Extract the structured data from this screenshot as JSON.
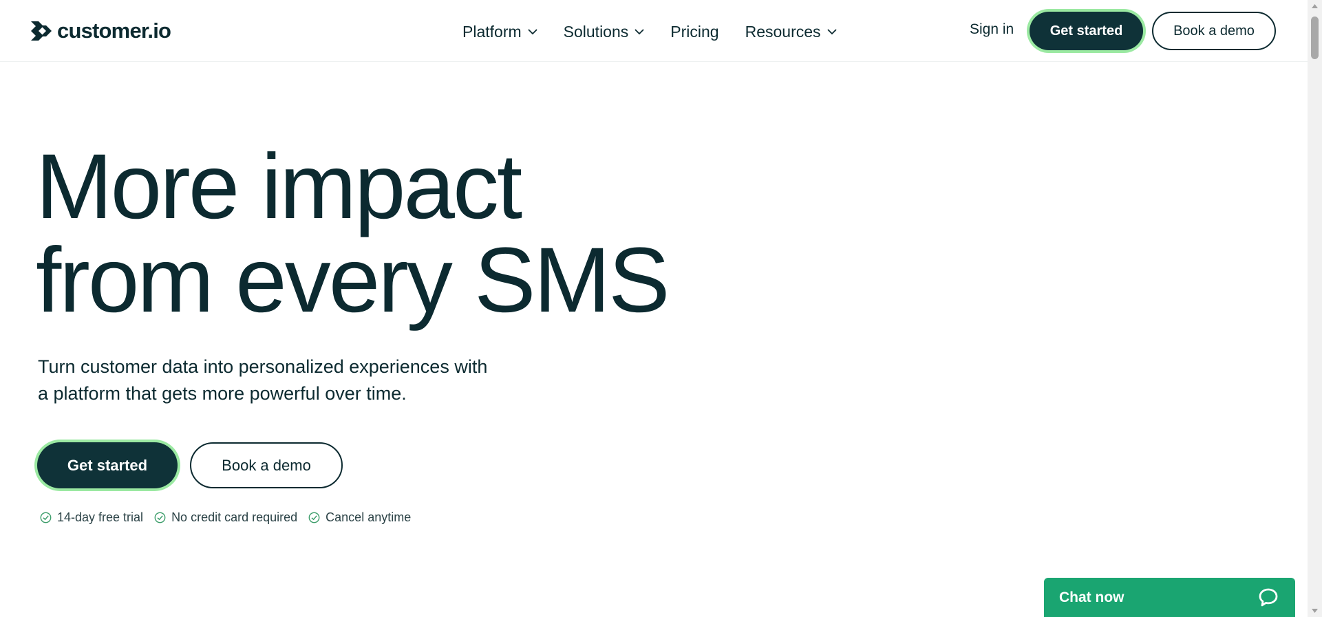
{
  "brand": {
    "name": "customer.io"
  },
  "nav": {
    "items": [
      {
        "label": "Platform",
        "has_dropdown": true
      },
      {
        "label": "Solutions",
        "has_dropdown": true
      },
      {
        "label": "Pricing",
        "has_dropdown": false
      },
      {
        "label": "Resources",
        "has_dropdown": true
      }
    ]
  },
  "header": {
    "sign_in": "Sign in",
    "get_started": "Get started",
    "book_demo": "Book a demo"
  },
  "hero": {
    "title_line_1": "More impact",
    "title_line_2": "from every SMS",
    "subtitle_line_1": "Turn customer data into personalized experiences with",
    "subtitle_line_2": "a platform that gets more powerful over time.",
    "get_started": "Get started",
    "book_demo": "Book a demo",
    "perks": [
      "14-day free trial",
      "No credit card required",
      "Cancel anytime"
    ]
  },
  "chat": {
    "label": "Chat now"
  },
  "colors": {
    "primary_dark": "#0f3238",
    "accent_green": "#9be9a2",
    "chat_green": "#1aa571",
    "text": "#0c2a30"
  },
  "icons": {
    "logo": "double-chevron-logo",
    "dropdown": "chevron-down-icon",
    "perk": "check-circle-icon",
    "chat": "chat-bubble-icon"
  }
}
